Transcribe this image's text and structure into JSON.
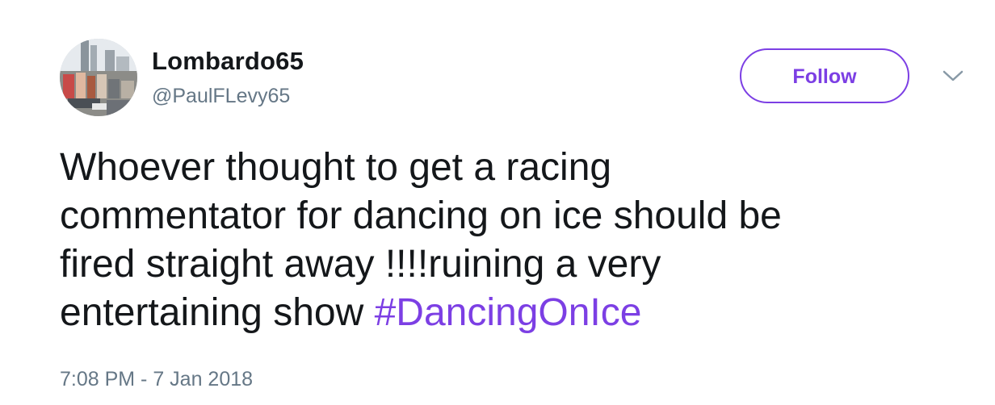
{
  "user": {
    "display_name": "Lombardo65",
    "handle": "@PaulFLevy65"
  },
  "actions": {
    "follow_label": "Follow",
    "menu_icon": "chevron-down-icon"
  },
  "tweet": {
    "text_lines": [
      "Whoever thought to get a racing",
      "commentator for dancing on ice should be",
      "fired straight away !!!!ruining a very",
      "entertaining show "
    ],
    "hashtag": "#DancingOnIce",
    "timestamp": "7:08 PM - 7 Jan 2018"
  },
  "colors": {
    "accent": "#7c3fe4",
    "text": "#14171a",
    "secondary": "#657786"
  }
}
